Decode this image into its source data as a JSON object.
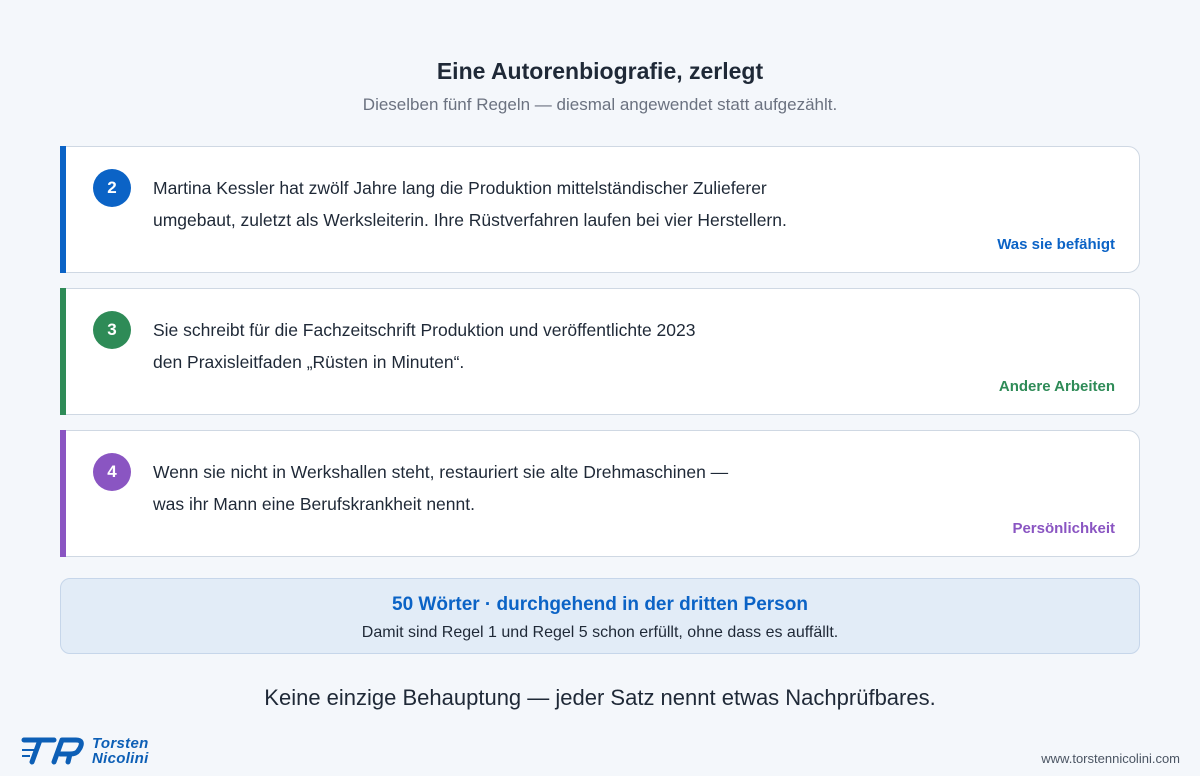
{
  "header": {
    "title": "Eine Autorenbiografie, zerlegt",
    "subtitle": "Dieselben fünf Regeln — diesmal angewendet statt aufgezählt."
  },
  "colors": {
    "blue": "#0b63c6",
    "green": "#2e8b57",
    "purple": "#8a55c2"
  },
  "cards": [
    {
      "number": "2",
      "lines": [
        "Martina Kessler hat zwölf Jahre lang die Produktion mittelständischer Zulieferer",
        "umgebaut, zuletzt als Werksleiterin. Ihre Rüstverfahren laufen bei vier Herstellern."
      ],
      "tag": "Was sie befähigt"
    },
    {
      "number": "3",
      "lines": [
        "Sie schreibt für die Fachzeitschrift Produktion und veröffentlichte 2023",
        "den Praxisleitfaden „Rüsten in Minuten“."
      ],
      "tag": "Andere Arbeiten"
    },
    {
      "number": "4",
      "lines": [
        "Wenn sie nicht in Werkshallen steht, restauriert sie alte Drehmaschinen —",
        "was ihr Mann eine Berufskrankheit nennt."
      ],
      "tag": "Persönlichkeit"
    }
  ],
  "summary": {
    "headline": "50 Wörter · durchgehend in der dritten Person",
    "body": "Damit sind Regel 1 und Regel 5 schon erfüllt, ohne dass es auffällt."
  },
  "statement": "Keine einzige Behauptung — jeder Satz nennt etwas Nachprüfbares.",
  "footer": {
    "logo_line1": "Torsten",
    "logo_line2": "Nicolini",
    "website": "www.torstennicolini.com"
  }
}
